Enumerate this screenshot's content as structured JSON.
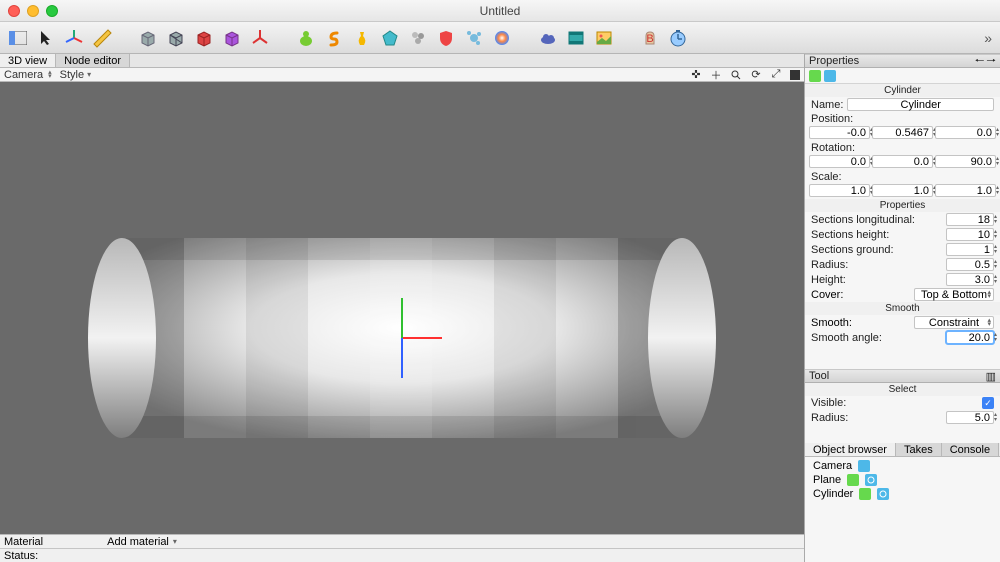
{
  "title": "Untitled",
  "toolbar": {
    "overflow": "»"
  },
  "tabs": {
    "view3d": "3D view",
    "nodeeditor": "Node editor"
  },
  "subbar": {
    "camera": "Camera",
    "style": "Style"
  },
  "bottombar": {
    "material": "Material",
    "addmaterial": "Add material"
  },
  "status_label": "Status:",
  "properties": {
    "header": "Properties",
    "object_type": "Cylinder",
    "name_label": "Name:",
    "name_value": "Cylinder",
    "position_label": "Position:",
    "position": [
      "-0.0",
      "0.5467",
      "0.0"
    ],
    "rotation_label": "Rotation:",
    "rotation": [
      "0.0",
      "0.0",
      "90.0"
    ],
    "scale_label": "Scale:",
    "scale": [
      "1.0",
      "1.0",
      "1.0"
    ],
    "properties_sub": "Properties",
    "sections_long_label": "Sections longitudinal:",
    "sections_long": "18",
    "sections_height_label": "Sections height:",
    "sections_height": "10",
    "sections_ground_label": "Sections ground:",
    "sections_ground": "1",
    "radius_label": "Radius:",
    "radius": "0.5",
    "height_label": "Height:",
    "height": "3.0",
    "cover_label": "Cover:",
    "cover": "Top & Bottom",
    "smooth_header": "Smooth",
    "smooth_label": "Smooth:",
    "smooth_value": "Constraint",
    "smooth_angle_label": "Smooth angle:",
    "smooth_angle": "20.0"
  },
  "tool": {
    "header": "Tool",
    "select": "Select",
    "visible_label": "Visible:",
    "radius_label": "Radius:",
    "radius": "5.0"
  },
  "browser": {
    "tabs": {
      "objects": "Object browser",
      "takes": "Takes",
      "console": "Console"
    },
    "items": [
      {
        "name": "Camera",
        "color": "#4db8e8",
        "extra": false
      },
      {
        "name": "Plane",
        "color": "#66d94d",
        "extra": true
      },
      {
        "name": "Cylinder",
        "color": "#66d94d",
        "extra": true
      }
    ]
  }
}
